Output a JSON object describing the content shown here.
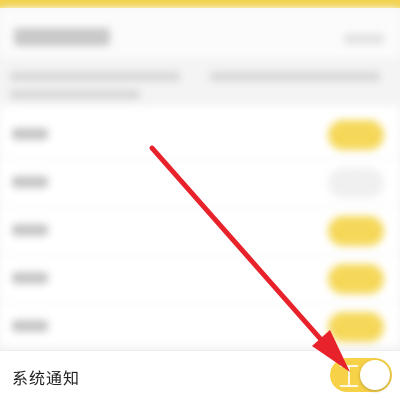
{
  "settings": {
    "system_notification_label": "系统通知",
    "system_notification_on": true
  },
  "accent_color": "#f7d148",
  "annotation": {
    "arrow_color": "#e8222a",
    "watermark_color": "#ffffff"
  },
  "icons": {
    "arrow": "red-arrow-annotation-icon",
    "watermark": "baidu-jingyan-watermark-icon"
  }
}
